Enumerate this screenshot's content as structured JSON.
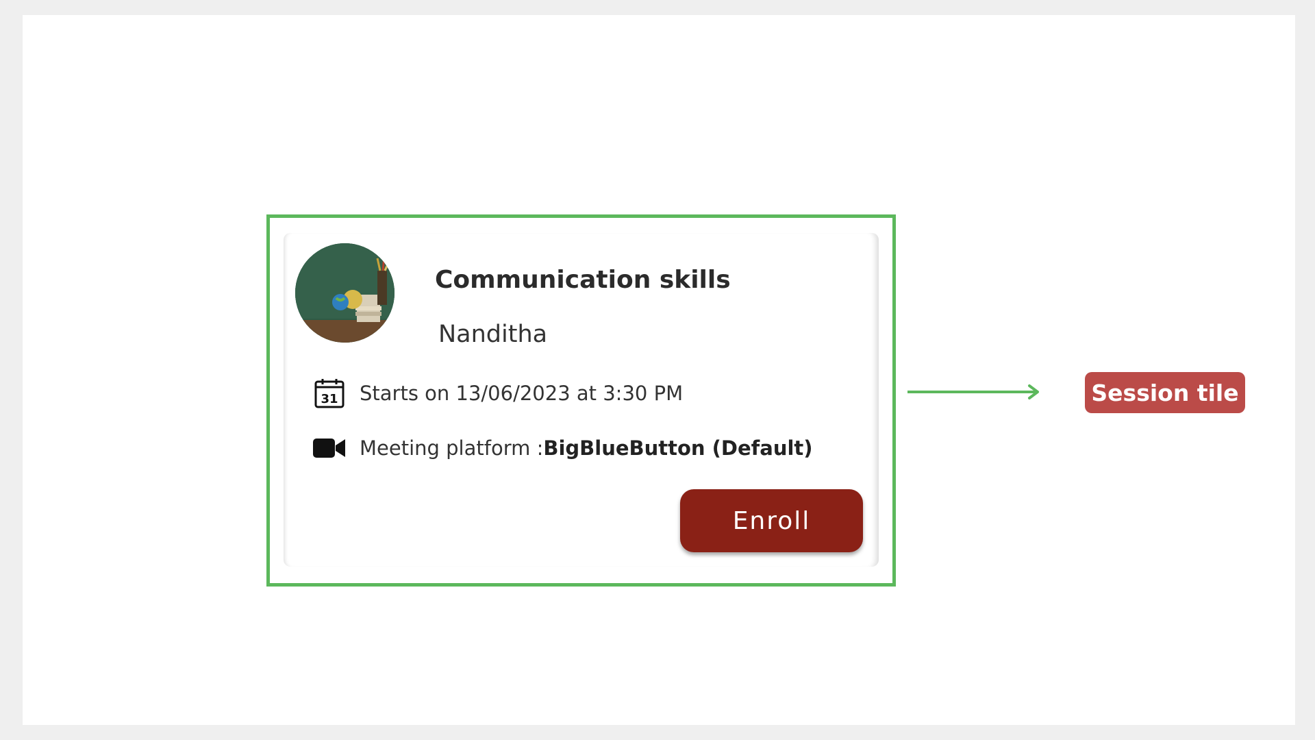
{
  "session": {
    "title": "Communication skills",
    "host": "Nanditha",
    "date_label": "Starts on 13/06/2023 at 3:30 PM",
    "platform_label": "Meeting platform : ",
    "platform_value": "BigBlueButton (Default)",
    "enroll_label": "Enroll",
    "calendar_day": "31"
  },
  "annotation": {
    "label": "Session tile"
  },
  "colors": {
    "highlight": "#5cb85c",
    "enroll_button": "#8a2116",
    "callout": "#bb4b48"
  }
}
